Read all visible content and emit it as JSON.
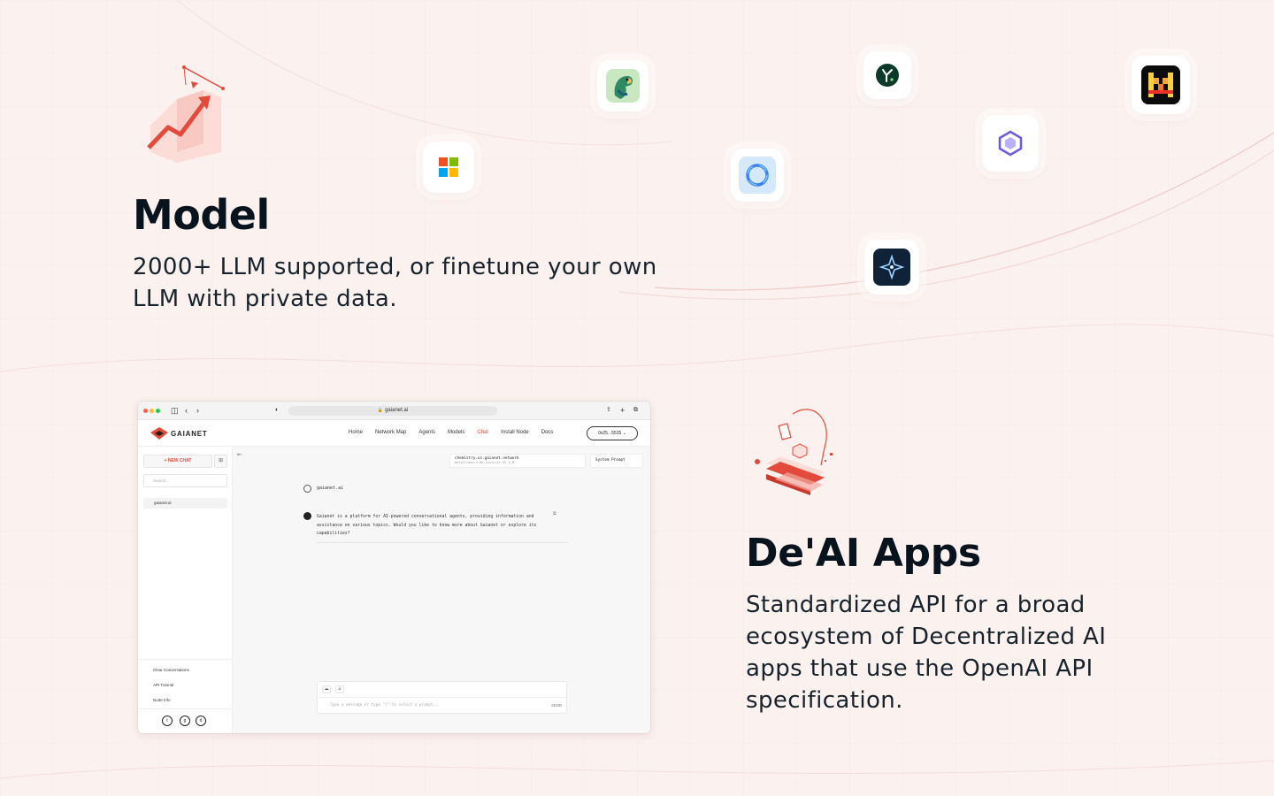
{
  "model_section": {
    "title": "Model",
    "description": "2000+ LLM supported, or finetune your own LLM with private data.",
    "illustration_icon": "chart-arrow-illustration"
  },
  "logo_tiles": [
    {
      "name": "parrot-logo-icon"
    },
    {
      "name": "microsoft-logo-icon"
    },
    {
      "name": "yi-logo-icon"
    },
    {
      "name": "ring-logo-icon"
    },
    {
      "name": "qwen-logo-icon"
    },
    {
      "name": "mistral-logo-icon"
    },
    {
      "name": "sparkle-logo-icon"
    }
  ],
  "browser": {
    "url": "gaianet.ai",
    "brand": "GAIANET",
    "nav": [
      "Home",
      "Network Map",
      "Agents",
      "Models",
      "Chat",
      "Install Node",
      "Docs"
    ],
    "active_nav": "Chat",
    "wallet": "0x25...5525",
    "sidebar": {
      "new_chat": "+ NEW CHAT",
      "search_placeholder": "Search...",
      "conversations": [
        "gaianet.ai"
      ],
      "links": [
        "Clear Conversations",
        "API Tutorial",
        "Node Info"
      ]
    },
    "chat": {
      "model_name": "chemistry.us.gaianet.network",
      "model_sub": "meta/Llama-3-8b-Instruct-Q5_K_M",
      "system_prompt": "System Prompt",
      "user_message": "gaianet.ai",
      "ai_message": "Gaianet is a platform for AI-powered conversational agents, providing information and assistance on various topics. Would you like to know more about Gaianet or explore its capabilities?",
      "input_placeholder": "Type a message or type \"/\" to select a prompt...",
      "send_label": "SEND"
    }
  },
  "apps_section": {
    "title": "De'AI Apps",
    "description": "Standardized API for a broad ecosystem of Decentralized AI apps that use the OpenAI API specification.",
    "illustration_icon": "app-stack-illustration"
  },
  "colors": {
    "accent": "#e24a3b",
    "background": "#fbf1ef",
    "heading": "#07141d"
  }
}
